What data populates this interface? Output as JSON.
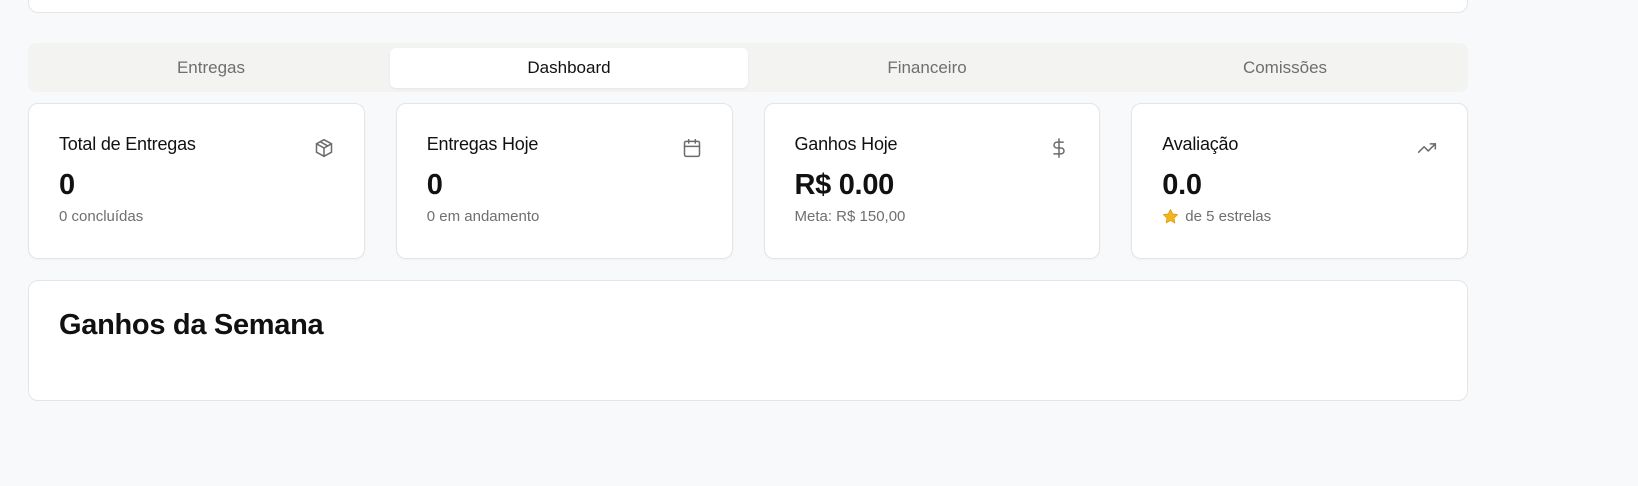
{
  "tabs": [
    {
      "label": "Entregas",
      "active": false
    },
    {
      "label": "Dashboard",
      "active": true
    },
    {
      "label": "Financeiro",
      "active": false
    },
    {
      "label": "Comissões",
      "active": false
    }
  ],
  "stats": [
    {
      "title": "Total de Entregas",
      "value": "0",
      "sub": "0 concluídas",
      "icon": "package-icon"
    },
    {
      "title": "Entregas Hoje",
      "value": "0",
      "sub": "0 em andamento",
      "icon": "calendar-icon"
    },
    {
      "title": "Ganhos Hoje",
      "value": "R$ 0.00",
      "sub": "Meta: R$ 150,00",
      "icon": "dollar-icon"
    },
    {
      "title": "Avaliação",
      "value": "0.0",
      "sub": "de 5 estrelas",
      "icon": "trending-up-icon"
    }
  ],
  "week_section": {
    "title": "Ganhos da Semana"
  },
  "colors": {
    "background": "#f8f9fb",
    "tabs_bg": "#f3f3f1",
    "star": "#f2b51c"
  }
}
